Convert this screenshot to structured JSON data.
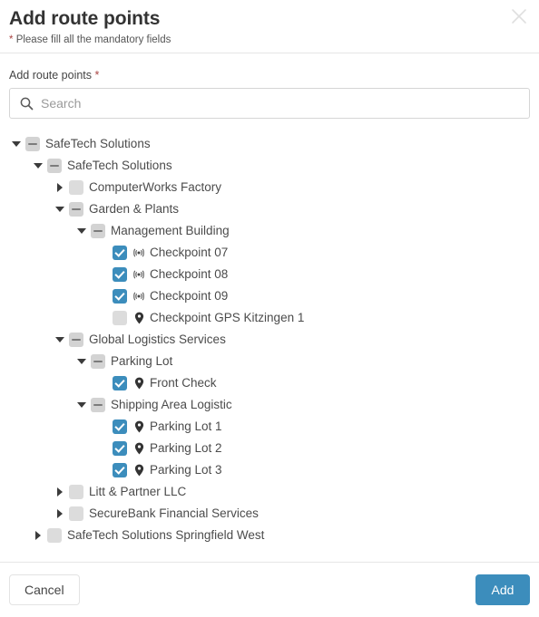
{
  "dialog": {
    "title": "Add route points",
    "mandatory_note": "Please fill all the mandatory fields",
    "required_marker": "*",
    "close_icon": "close-icon"
  },
  "form": {
    "field_label": "Add route points",
    "required_marker": "*",
    "search": {
      "value": "",
      "placeholder": "Search",
      "icon": "search-icon"
    }
  },
  "colors": {
    "accent": "#3c8dbc",
    "checkbox_checked": "#3c8dbc",
    "checkbox_unchecked": "#dcdcdc",
    "checkbox_indeterminate": "#d3d3d3",
    "required_star": "#a94442",
    "text": "#4b4b4b"
  },
  "tree": {
    "nodes": [
      {
        "label": "SafeTech Solutions",
        "depth": 0,
        "toggle": "down",
        "check": "indeterminate",
        "icon": "none"
      },
      {
        "label": "SafeTech Solutions",
        "depth": 1,
        "toggle": "down",
        "check": "indeterminate",
        "icon": "none"
      },
      {
        "label": "ComputerWorks Factory",
        "depth": 2,
        "toggle": "right",
        "check": "unchecked",
        "icon": "none"
      },
      {
        "label": "Garden & Plants",
        "depth": 2,
        "toggle": "down",
        "check": "indeterminate",
        "icon": "none"
      },
      {
        "label": "Management Building",
        "depth": 3,
        "toggle": "down",
        "check": "indeterminate",
        "icon": "none"
      },
      {
        "label": "Checkpoint 07",
        "depth": 4,
        "toggle": "none",
        "check": "checked",
        "icon": "nfc-checkpoint-icon"
      },
      {
        "label": "Checkpoint 08",
        "depth": 4,
        "toggle": "none",
        "check": "checked",
        "icon": "nfc-checkpoint-icon"
      },
      {
        "label": "Checkpoint 09",
        "depth": 4,
        "toggle": "none",
        "check": "checked",
        "icon": "nfc-checkpoint-icon"
      },
      {
        "label": "Checkpoint GPS Kitzingen 1",
        "depth": 4,
        "toggle": "none",
        "check": "unchecked",
        "icon": "map-pin-icon"
      },
      {
        "label": "Global Logistics Services",
        "depth": 2,
        "toggle": "down",
        "check": "indeterminate",
        "icon": "none"
      },
      {
        "label": "Parking Lot",
        "depth": 3,
        "toggle": "down",
        "check": "indeterminate",
        "icon": "none"
      },
      {
        "label": "Front Check",
        "depth": 4,
        "toggle": "none",
        "check": "checked",
        "icon": "map-pin-icon"
      },
      {
        "label": "Shipping Area Logistic",
        "depth": 3,
        "toggle": "down",
        "check": "indeterminate",
        "icon": "none"
      },
      {
        "label": "Parking Lot 1",
        "depth": 4,
        "toggle": "none",
        "check": "checked",
        "icon": "map-pin-icon"
      },
      {
        "label": "Parking Lot 2",
        "depth": 4,
        "toggle": "none",
        "check": "checked",
        "icon": "map-pin-icon"
      },
      {
        "label": "Parking Lot 3",
        "depth": 4,
        "toggle": "none",
        "check": "checked",
        "icon": "map-pin-icon"
      },
      {
        "label": "Litt & Partner LLC",
        "depth": 2,
        "toggle": "right",
        "check": "unchecked",
        "icon": "none"
      },
      {
        "label": "SecureBank Financial Services",
        "depth": 2,
        "toggle": "right",
        "check": "unchecked",
        "icon": "none"
      },
      {
        "label": "SafeTech Solutions Springfield West",
        "depth": 1,
        "toggle": "right",
        "check": "unchecked",
        "icon": "none"
      }
    ]
  },
  "footer": {
    "cancel_label": "Cancel",
    "add_label": "Add"
  }
}
